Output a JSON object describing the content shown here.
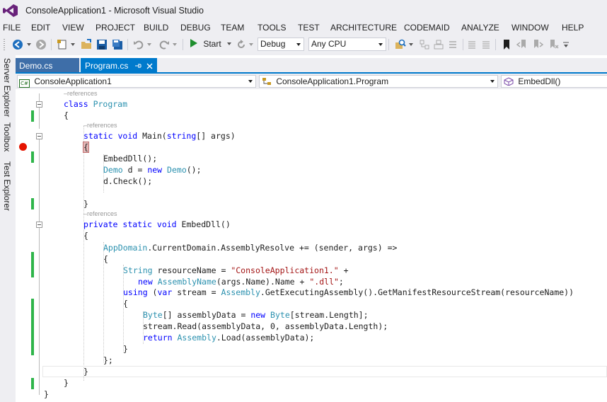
{
  "window": {
    "title": "ConsoleApplication1 - Microsoft Visual Studio"
  },
  "menu": [
    "FILE",
    "EDIT",
    "VIEW",
    "PROJECT",
    "BUILD",
    "DEBUG",
    "TEAM",
    "TOOLS",
    "TEST",
    "ARCHITECTURE",
    "CODEMAID",
    "ANALYZE",
    "WINDOW",
    "HELP"
  ],
  "toolbar": {
    "start_label": "Start",
    "config": "Debug",
    "platform": "Any CPU"
  },
  "sidebar": [
    "Server Explorer",
    "Toolbox",
    "Test Explorer"
  ],
  "tabs": [
    {
      "label": "Demo.cs"
    },
    {
      "label": "Program.cs"
    }
  ],
  "nav": {
    "project": "ConsoleApplication1",
    "type": "ConsoleApplication1.Program",
    "member": "EmbedDll()"
  },
  "code": {
    "refs": "–references",
    "l_class": "class Program",
    "l_brace_open": "{",
    "l_main": "static void Main(string[] args)",
    "l_embed_call": "EmbedDll();",
    "l_demo": "Demo d = new Demo();",
    "l_check": "d.Check();",
    "l_brace_close": "}",
    "l_private": "private static void EmbedDll()",
    "l_appdomain": "AppDomain.CurrentDomain.AssemblyResolve += (sender, args) =>",
    "l_resname": "String resourceName = \"ConsoleApplication1.\" +",
    "l_newasm": "new AssemblyName(args.Name).Name + \".dll\";",
    "l_using": "using (var stream = Assembly.GetExecutingAssembly().GetManifestResourceStream(resourceName))",
    "l_bytes": "Byte[] assemblyData = new Byte[stream.Length];",
    "l_read": "stream.Read(assemblyData, 0, assemblyData.Length);",
    "l_return": "return Assembly.Load(assemblyData);",
    "l_close_semi": "};"
  }
}
